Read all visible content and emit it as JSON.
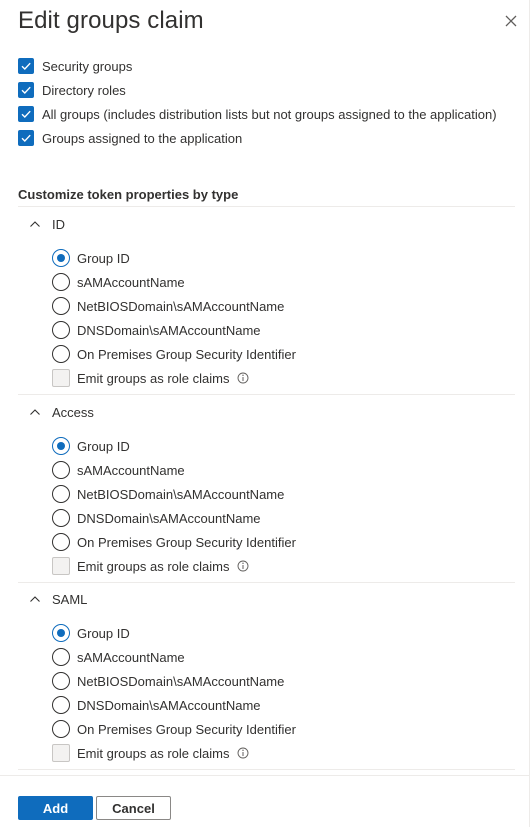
{
  "dialog": {
    "title": "Edit groups claim"
  },
  "group_types": [
    {
      "label": "Security groups",
      "checked": true
    },
    {
      "label": "Directory roles",
      "checked": true
    },
    {
      "label": "All groups (includes distribution lists but not groups assigned to the application)",
      "checked": true
    },
    {
      "label": "Groups assigned to the application",
      "checked": true
    }
  ],
  "customize": {
    "heading": "Customize token properties by type",
    "sections": [
      {
        "name": "ID",
        "expanded": true,
        "options": [
          "Group ID",
          "sAMAccountName",
          "NetBIOSDomain\\sAMAccountName",
          "DNSDomain\\sAMAccountName",
          "On Premises Group Security Identifier"
        ],
        "selected": "Group ID",
        "emit_label": "Emit groups as role claims",
        "emit_checked": false
      },
      {
        "name": "Access",
        "expanded": true,
        "options": [
          "Group ID",
          "sAMAccountName",
          "NetBIOSDomain\\sAMAccountName",
          "DNSDomain\\sAMAccountName",
          "On Premises Group Security Identifier"
        ],
        "selected": "Group ID",
        "emit_label": "Emit groups as role claims",
        "emit_checked": false
      },
      {
        "name": "SAML",
        "expanded": true,
        "options": [
          "Group ID",
          "sAMAccountName",
          "NetBIOSDomain\\sAMAccountName",
          "DNSDomain\\sAMAccountName",
          "On Premises Group Security Identifier"
        ],
        "selected": "Group ID",
        "emit_label": "Emit groups as role claims",
        "emit_checked": false
      }
    ]
  },
  "footer": {
    "add_label": "Add",
    "cancel_label": "Cancel"
  },
  "colors": {
    "accent": "#0f6cbd",
    "text": "#323130",
    "divider": "#edebe9"
  },
  "icons": {
    "close": "close-icon",
    "chevron": "chevron-up-icon",
    "info": "info-icon",
    "check": "checkmark-icon"
  }
}
